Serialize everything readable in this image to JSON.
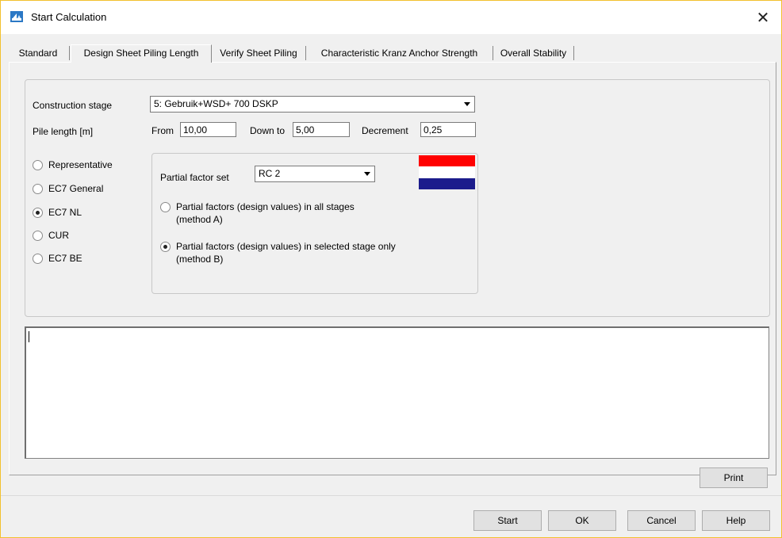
{
  "window": {
    "title": "Start Calculation",
    "close_glyph": "✕"
  },
  "tabs": [
    {
      "label": "Standard",
      "active": false
    },
    {
      "label": "Design Sheet Piling Length",
      "active": true
    },
    {
      "label": "Verify Sheet Piling",
      "active": false
    },
    {
      "label": "Characteristic Kranz Anchor Strength",
      "active": false
    },
    {
      "label": "Overall Stability",
      "active": false
    }
  ],
  "form": {
    "construction_stage_label": "Construction stage",
    "construction_stage_value": "5: Gebruik+WSD+ 700 DSKP",
    "pile_length_label": "Pile length  [m]",
    "from_label": "From",
    "from_value": "10,00",
    "down_to_label": "Down to",
    "down_to_value": "5,00",
    "decrement_label": "Decrement",
    "decrement_value": "0,25"
  },
  "verification_methods": [
    {
      "label": "Representative",
      "checked": false
    },
    {
      "label": "EC7 General",
      "checked": false
    },
    {
      "label": "EC7 NL",
      "checked": true
    },
    {
      "label": "CUR",
      "checked": false
    },
    {
      "label": "EC7 BE",
      "checked": false
    }
  ],
  "partial": {
    "set_label": "Partial factor set",
    "set_value": "RC 2",
    "option_a_line1": "Partial factors (design values) in all stages",
    "option_a_line2": "(method A)",
    "option_a_checked": false,
    "option_b_line1": "Partial factors (design values) in selected stage only",
    "option_b_line2": "(method B)",
    "option_b_checked": true,
    "flag_icon": "netherlands-flag",
    "flag_colors": [
      "#ff0000",
      "#ffffff",
      "#1c1c8c"
    ]
  },
  "memo": {
    "content": ""
  },
  "buttons": {
    "print": "Print",
    "start": "Start",
    "ok": "OK",
    "cancel": "Cancel",
    "help": "Help"
  }
}
